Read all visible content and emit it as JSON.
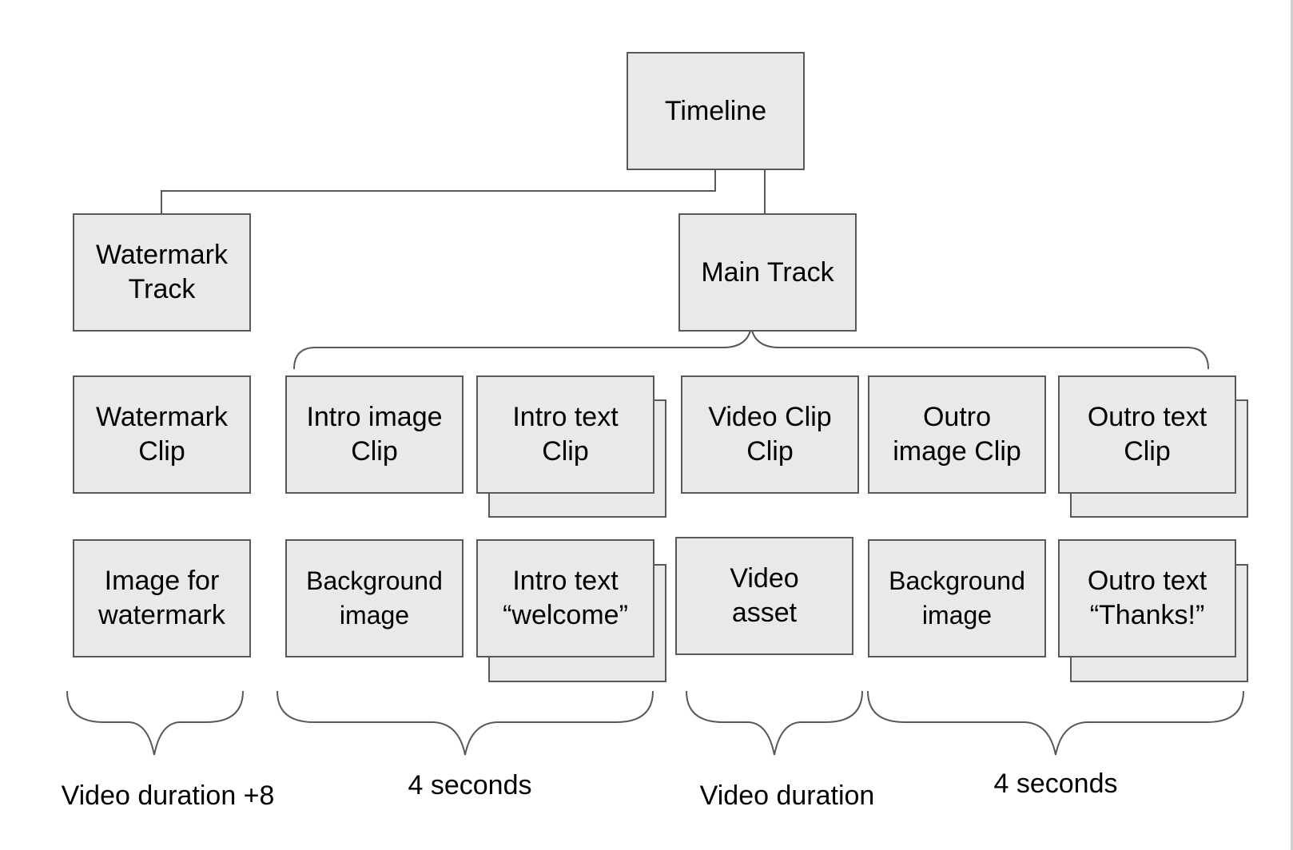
{
  "diagram": {
    "root": {
      "label": "Timeline"
    },
    "tracks": [
      {
        "id": "watermark_track",
        "label": "Watermark\nTrack"
      },
      {
        "id": "main_track",
        "label": "Main Track"
      }
    ],
    "clips": [
      {
        "label": "Watermark\nClip",
        "stacked": false
      },
      {
        "label": "Intro image\nClip",
        "stacked": false
      },
      {
        "label": "Intro text\nClip",
        "stacked": true
      },
      {
        "label": "Video Clip\nClip",
        "stacked": false
      },
      {
        "label": "Outro\nimage Clip",
        "stacked": false
      },
      {
        "label": "Outro text\nClip",
        "stacked": true
      }
    ],
    "assets": [
      {
        "label": "Image for\nwatermark",
        "stacked": false
      },
      {
        "label": "Background\nimage",
        "stacked": false
      },
      {
        "label": "Intro text\n“welcome”",
        "stacked": true
      },
      {
        "label": "Video\nasset",
        "stacked": false
      },
      {
        "label": "Background\nimage",
        "stacked": false
      },
      {
        "label": "Outro text\n“Thanks!”",
        "stacked": true
      }
    ],
    "durations": [
      {
        "label": "Video duration +8"
      },
      {
        "label": "4 seconds"
      },
      {
        "label": "Video duration"
      },
      {
        "label": "4 seconds"
      }
    ],
    "colors": {
      "box_fill": "#e9e9e9",
      "stroke": "#595959",
      "text": "#000000"
    }
  }
}
